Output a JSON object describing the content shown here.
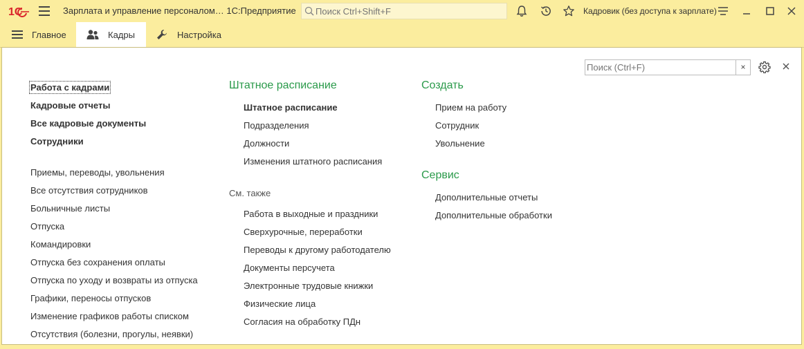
{
  "titlebar": {
    "logo_text": "1С",
    "app_title": "Зарплата и управление персоналом… 1С:Предприятие",
    "search_placeholder": "Поиск Ctrl+Shift+F",
    "user": "Кадровик (без доступа к зарплате)"
  },
  "tabs": [
    {
      "label": "Главное",
      "icon": "hamburger-icon"
    },
    {
      "label": "Кадры",
      "icon": "people-icon",
      "active": true
    },
    {
      "label": "Настройка",
      "icon": "wrench-icon"
    }
  ],
  "panel": {
    "search_placeholder": "Поиск (Ctrl+F)",
    "clear_label": "×"
  },
  "column1": {
    "main": [
      "Работа с кадрами",
      "Кадровые отчеты",
      "Все кадровые документы",
      "Сотрудники"
    ],
    "items": [
      "Приемы, переводы, увольнения",
      "Все отсутствия сотрудников",
      "Больничные листы",
      "Отпуска",
      "Командировки",
      "Отпуска без сохранения оплаты",
      "Отпуска по уходу и возвраты из отпуска",
      "Графики, переносы отпусков",
      "Изменение графиков работы списком",
      "Отсутствия (болезни, прогулы, неявки)"
    ]
  },
  "column2": {
    "title": "Штатное расписание",
    "items": [
      "Штатное расписание",
      "Подразделения",
      "Должности",
      "Изменения штатного расписания"
    ],
    "see_also_title": "См. также",
    "see_also": [
      "Работа в выходные и праздники",
      "Сверхурочные, переработки",
      "Переводы к другому работодателю",
      "Документы персучета",
      "Электронные трудовые книжки",
      "Физические лица",
      "Согласия на обработку ПДн"
    ]
  },
  "column3": {
    "create_title": "Создать",
    "create_items": [
      "Прием на работу",
      "Сотрудник",
      "Увольнение"
    ],
    "service_title": "Сервис",
    "service_items": [
      "Дополнительные отчеты",
      "Дополнительные обработки"
    ]
  },
  "colors": {
    "accent_green": "#2a9a4a",
    "toolbar_bg": "#fbed9e",
    "logo_red": "#d9262b"
  }
}
